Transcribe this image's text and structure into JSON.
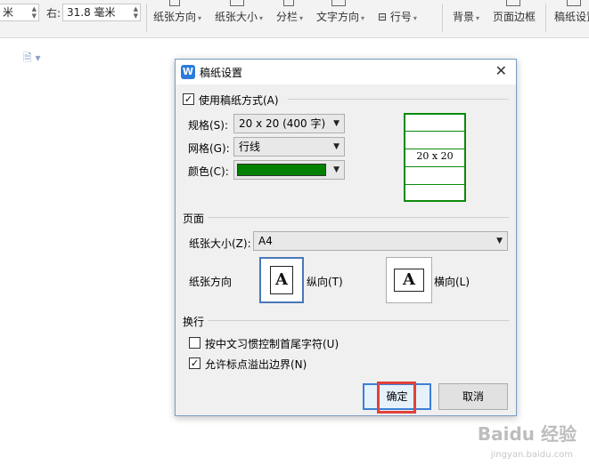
{
  "ribbon": {
    "left_unit": "米",
    "right_label": "右:",
    "right_value": "31.8 毫米",
    "buttons": [
      "纸张方向",
      "纸张大小",
      "分栏",
      "文字方向",
      "行号",
      "背景",
      "页面边框",
      "稿纸设置"
    ]
  },
  "dialog": {
    "title": "稿纸设置",
    "use_grid_label": "使用稿纸方式(A)",
    "use_grid_checked": true,
    "spec_label": "规格(S):",
    "spec_value": "20 x 20 (400 字)",
    "grid_label": "网格(G):",
    "grid_value": "行线",
    "color_label": "颜色(C):",
    "color_value": "#008000",
    "preview_text": "20 x 20",
    "page_group": "页面",
    "paper_size_label": "纸张大小(Z):",
    "paper_size_value": "A4",
    "orientation_label": "纸张方向",
    "portrait_label": "纵向(T)",
    "landscape_label": "横向(L)",
    "wrap_group": "换行",
    "wrap_option1": "按中文习惯控制首尾字符(U)",
    "wrap_option1_checked": false,
    "wrap_option2": "允许标点溢出边界(N)",
    "wrap_option2_checked": true,
    "ok_label": "确定",
    "cancel_label": "取消"
  },
  "watermark": {
    "brand": "Baidu 经验",
    "url": "jingyan.baidu.com"
  }
}
